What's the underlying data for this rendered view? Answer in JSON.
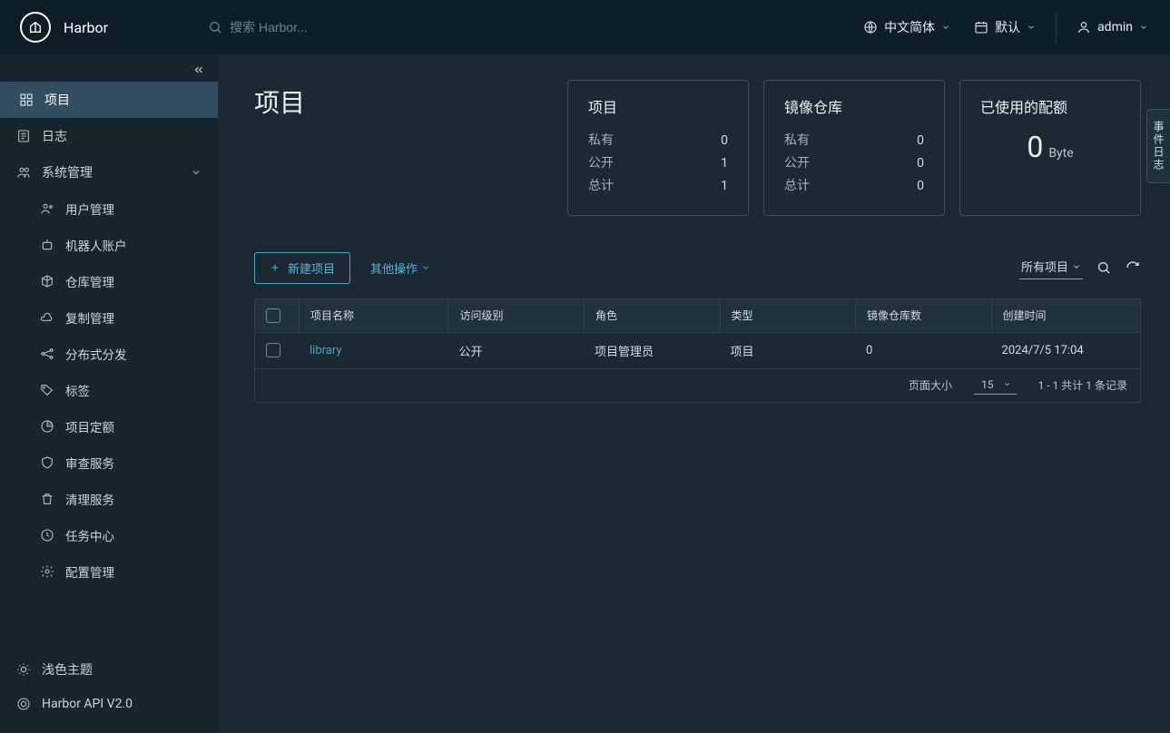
{
  "brand": "Harbor",
  "search_placeholder": "搜索 Harbor...",
  "topbar": {
    "language": "中文简体",
    "date_mode": "默认",
    "user": "admin"
  },
  "sidebar": {
    "items": [
      {
        "label": "项目",
        "active": true
      },
      {
        "label": "日志"
      },
      {
        "label": "系统管理",
        "expandable": true
      }
    ],
    "admin_children": [
      {
        "label": "用户管理"
      },
      {
        "label": "机器人账户"
      },
      {
        "label": "仓库管理"
      },
      {
        "label": "复制管理"
      },
      {
        "label": "分布式分发"
      },
      {
        "label": "标签"
      },
      {
        "label": "项目定额"
      },
      {
        "label": "审查服务"
      },
      {
        "label": "清理服务"
      },
      {
        "label": "任务中心"
      },
      {
        "label": "配置管理"
      }
    ],
    "footer": {
      "theme": "浅色主题",
      "api": "Harbor API V2.0"
    }
  },
  "page": {
    "title": "项目",
    "events_tab": "事件日志"
  },
  "cards": {
    "projects": {
      "title": "项目",
      "private_label": "私有",
      "private_val": "0",
      "public_label": "公开",
      "public_val": "1",
      "total_label": "总计",
      "total_val": "1"
    },
    "repos": {
      "title": "镜像仓库",
      "private_label": "私有",
      "private_val": "0",
      "public_label": "公开",
      "public_val": "0",
      "total_label": "总计",
      "total_val": "0"
    },
    "quota": {
      "title": "已使用的配额",
      "value": "0",
      "unit": "Byte"
    }
  },
  "actions": {
    "new_project": "新建项目",
    "other_ops": "其他操作",
    "filter": "所有项目"
  },
  "table": {
    "headers": [
      "项目名称",
      "访问级别",
      "角色",
      "类型",
      "镜像仓库数",
      "创建时间"
    ],
    "rows": [
      {
        "name": "library",
        "access": "公开",
        "role": "项目管理员",
        "type": "项目",
        "repo_count": "0",
        "created": "2024/7/5 17:04"
      }
    ],
    "footer": {
      "page_size_label": "页面大小",
      "page_size": "15",
      "range": "1 - 1 共计 1 条记录"
    }
  }
}
